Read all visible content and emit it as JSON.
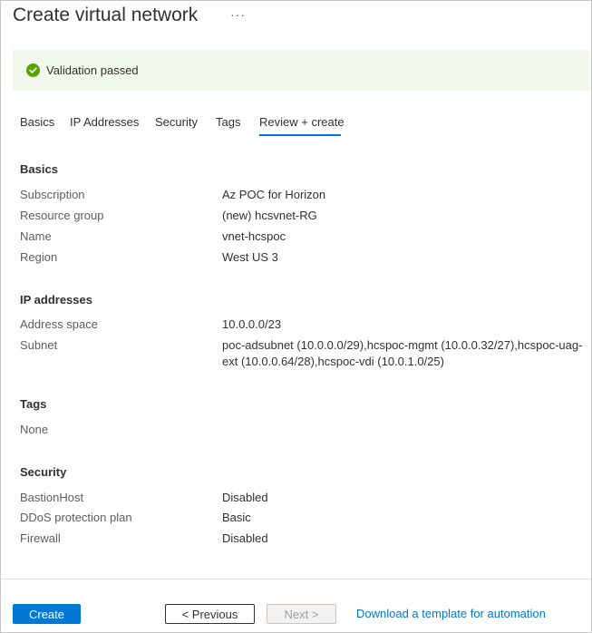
{
  "header": {
    "title": "Create virtual network",
    "more_label": "···"
  },
  "validation": {
    "text": "Validation passed",
    "status_color": "#57a300"
  },
  "tabs": [
    {
      "label": "Basics"
    },
    {
      "label": "IP Addresses"
    },
    {
      "label": "Security"
    },
    {
      "label": "Tags"
    },
    {
      "label": "Review + create",
      "active": true
    }
  ],
  "sections": {
    "basics": {
      "heading": "Basics",
      "rows": [
        {
          "label": "Subscription",
          "value": "Az POC for Horizon"
        },
        {
          "label": "Resource group",
          "value": "(new) hcsvnet-RG"
        },
        {
          "label": "Name",
          "value": "vnet-hcspoc"
        },
        {
          "label": "Region",
          "value": "West US 3"
        }
      ]
    },
    "ip": {
      "heading": "IP addresses",
      "rows": [
        {
          "label": "Address space",
          "value": "10.0.0.0/23"
        },
        {
          "label": "Subnet",
          "value": "poc-adsubnet (10.0.0.0/29),hcspoc-mgmt (10.0.0.32/27),hcspoc-uag-ext (10.0.0.64/28),hcspoc-vdi (10.0.1.0/25)"
        }
      ]
    },
    "tags": {
      "heading": "Tags",
      "rows": [
        {
          "label": "None"
        }
      ]
    },
    "security": {
      "heading": "Security",
      "rows": [
        {
          "label": "BastionHost",
          "value": "Disabled"
        },
        {
          "label": "DDoS protection plan",
          "value": "Basic"
        },
        {
          "label": "Firewall",
          "value": "Disabled"
        }
      ]
    }
  },
  "footer": {
    "create_label": "Create",
    "previous_label": "< Previous",
    "next_label": "Next >",
    "download_link": "Download a template for automation",
    "accent_color": "#0078d4"
  }
}
